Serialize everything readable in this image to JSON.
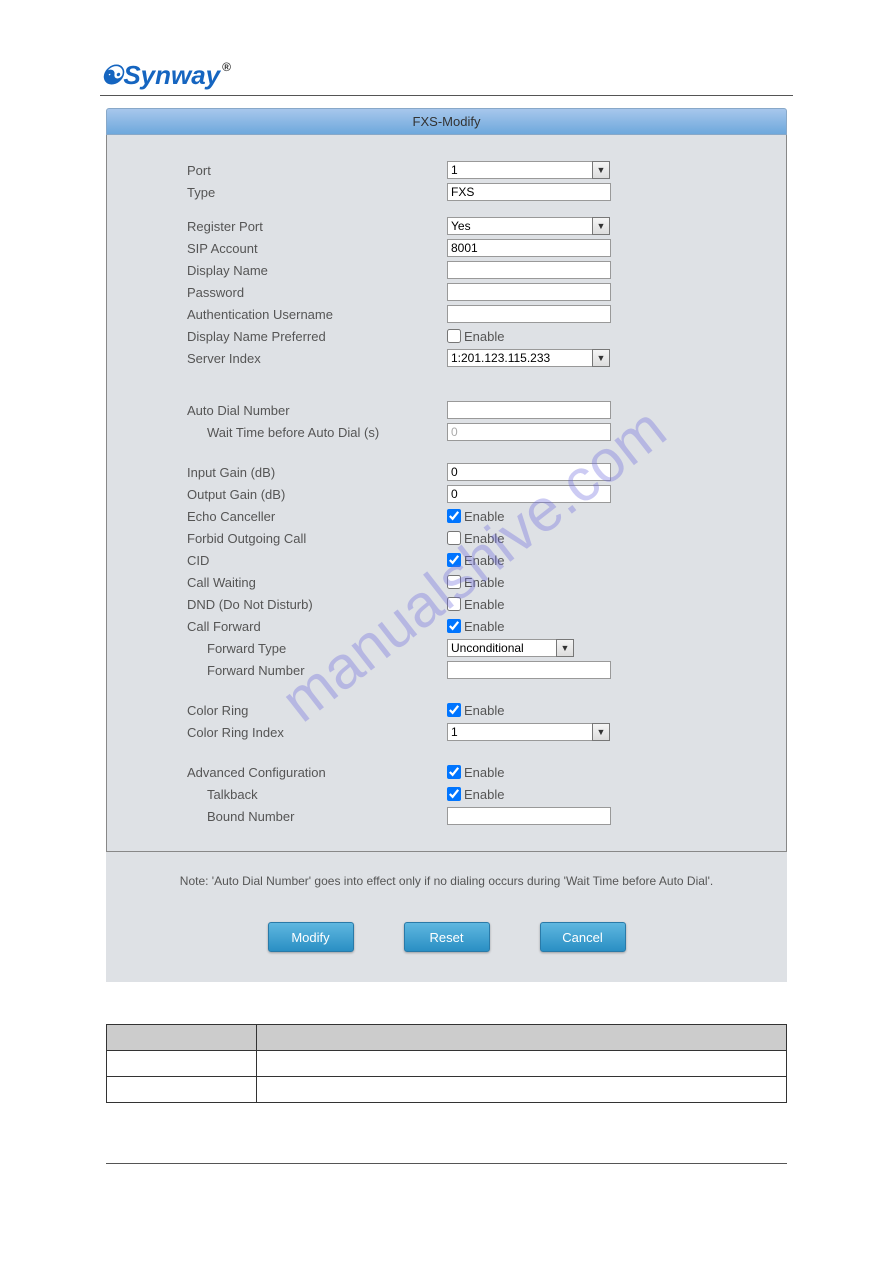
{
  "logo": {
    "text": "Synway",
    "reg": "®"
  },
  "panel_title": "FXS-Modify",
  "labels": {
    "port": "Port",
    "type": "Type",
    "register_port": "Register Port",
    "sip_account": "SIP Account",
    "display_name": "Display Name",
    "password": "Password",
    "auth_username": "Authentication Username",
    "display_name_pref": "Display Name Preferred",
    "server_index": "Server Index",
    "auto_dial_number": "Auto Dial Number",
    "wait_time": "Wait Time before Auto Dial (s)",
    "input_gain": "Input Gain (dB)",
    "output_gain": "Output Gain (dB)",
    "echo_canceller": "Echo Canceller",
    "forbid_outgoing": "Forbid Outgoing Call",
    "cid": "CID",
    "call_waiting": "Call Waiting",
    "dnd": "DND (Do Not Disturb)",
    "call_forward": "Call Forward",
    "forward_type": "Forward Type",
    "forward_number": "Forward Number",
    "color_ring": "Color Ring",
    "color_ring_index": "Color Ring Index",
    "advanced_config": "Advanced Configuration",
    "talkback": "Talkback",
    "bound_number": "Bound Number",
    "enable": "Enable"
  },
  "values": {
    "port": "1",
    "type": "FXS",
    "register_port": "Yes",
    "sip_account": "8001",
    "display_name": "",
    "password": "",
    "auth_username": "",
    "server_index": "1:201.123.115.233",
    "auto_dial_number": "",
    "wait_time": "0",
    "input_gain": "0",
    "output_gain": "0",
    "forward_type": "Unconditional",
    "forward_number": "",
    "color_ring_index": "1",
    "bound_number": ""
  },
  "checks": {
    "display_name_pref": false,
    "echo_canceller": true,
    "forbid_outgoing": false,
    "cid": true,
    "call_waiting": false,
    "dnd": false,
    "call_forward": true,
    "color_ring": true,
    "advanced_config": true,
    "talkback": true
  },
  "note": "Note: 'Auto Dial Number' goes into effect only if no dialing occurs during 'Wait Time before Auto Dial'.",
  "buttons": {
    "modify": "Modify",
    "reset": "Reset",
    "cancel": "Cancel"
  },
  "watermark": "manualshive.com"
}
